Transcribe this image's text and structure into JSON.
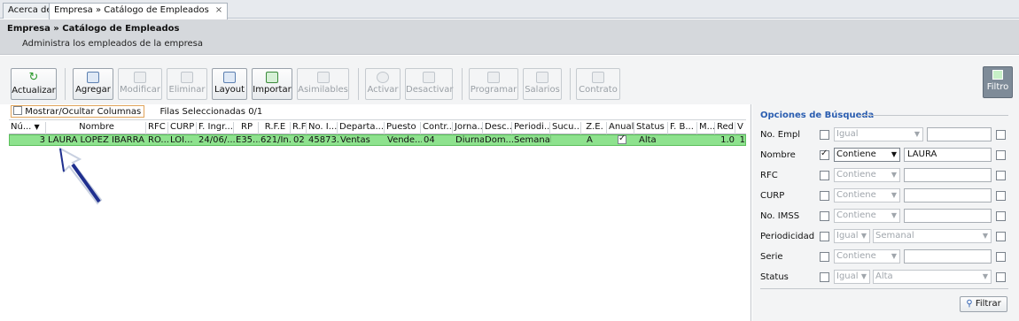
{
  "tabs": [
    {
      "label": "Acerca de"
    },
    {
      "label": "Empresa » Catálogo de Empleados",
      "close": "×"
    }
  ],
  "header": {
    "title": "Empresa » Catálogo de Empleados",
    "subtitle": "Administra los empleados de la empresa"
  },
  "toolbar": {
    "refresh_glyph": "↻",
    "actualizar": "Actualizar",
    "agregar": "Agregar",
    "modificar": "Modificar",
    "eliminar": "Eliminar",
    "layout": "Layout",
    "importar": "Importar",
    "asimilables": "Asimilables",
    "activar": "Activar",
    "desactivar": "Desactivar",
    "programar": "Programar",
    "salarios": "Salarios",
    "contrato": "Contrato",
    "filtro": "Filtro"
  },
  "grid": {
    "show_hide_columns": "Mostrar/Ocultar Columnas",
    "selected_rows": "Filas Seleccionadas  0/1",
    "columns": [
      "Nú...",
      "Nombre",
      "RFC",
      "CURP",
      "F. Ingr...",
      "RP",
      "R.F.E",
      "R.F",
      "No. I...",
      "Departa...",
      "Puesto",
      "Contr...",
      "Jorna...",
      "Desc...",
      "Periodi...",
      "Sucu...",
      "Z.E.",
      "Anual",
      "Status",
      "F. B...",
      "M...",
      "Red",
      "V"
    ],
    "row": {
      "num": "3",
      "nombre": "LAURA LOPEZ IBARRA",
      "rfc": "RO...",
      "curp": "LOI...",
      "fingreso": "24/06/...",
      "rp": "E35...",
      "rfe": "621/In...",
      "rf": "02",
      "noimss": "45873...",
      "departamento": "Ventas",
      "puesto": "Vende...",
      "contrato": "04",
      "jornada": "Diurna",
      "descanso": "Dom...",
      "periodicidad": "Semanal",
      "sucursal": "",
      "ze": "A",
      "anual_checked": true,
      "status": "Alta",
      "fbaja": "",
      "m": "",
      "red": "1.0",
      "v": "1"
    }
  },
  "filters": {
    "group_title": "Opciones de Búsqueda",
    "items": [
      {
        "label": "No. Empl",
        "checked": false,
        "op": "Igual",
        "value": ""
      },
      {
        "label": "Nombre",
        "checked": true,
        "op": "Contiene",
        "value": "LAURA"
      },
      {
        "label": "RFC",
        "checked": false,
        "op": "Contiene",
        "value": ""
      },
      {
        "label": "CURP",
        "checked": false,
        "op": "Contiene",
        "value": ""
      },
      {
        "label": "No. IMSS",
        "checked": false,
        "op": "Contiene",
        "value": ""
      },
      {
        "label": "Periodicidad",
        "checked": false,
        "op": "Igual",
        "value": "Semanal"
      },
      {
        "label": "Serie",
        "checked": false,
        "op": "Contiene",
        "value": ""
      },
      {
        "label": "Status",
        "checked": false,
        "op": "Igual",
        "value": "Alta"
      }
    ],
    "button": "Filtrar"
  },
  "colors": {
    "selected_row": "#8ee28e",
    "arrow": "#1f2f8f",
    "group_title": "#2a5db0"
  }
}
